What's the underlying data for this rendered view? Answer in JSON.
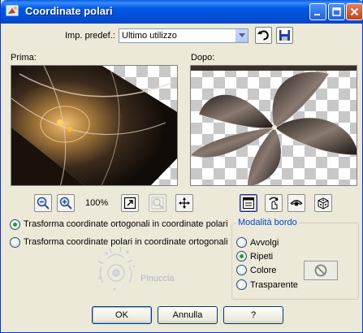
{
  "window": {
    "title": "Coordinate polari"
  },
  "presets": {
    "label": "Imp. predef.:",
    "value": "Ultimo utilizzo"
  },
  "panels": {
    "before_label": "Prima:",
    "after_label": "Dopo:"
  },
  "zoom": {
    "level": "100%"
  },
  "transform": {
    "options": [
      "Trasforma coordinate ortogonali in coordinate polari",
      "Trasforma coordinate polari in coordinate ortogonali"
    ],
    "selected_index": 0
  },
  "border_mode": {
    "title": "Modalità bordo",
    "options": [
      "Avvolgi",
      "Ripeti",
      "Colore",
      "Trasparente"
    ],
    "selected": "Ripeti"
  },
  "watermark": {
    "text": "Pinuccia"
  },
  "buttons": {
    "ok": "OK",
    "cancel": "Annulla",
    "help": "?"
  },
  "colors": {
    "title_bar": "#0058e6",
    "dialog_bg": "#ece9d8",
    "group_title": "#0046d5",
    "radio_dot": "#21a121"
  }
}
